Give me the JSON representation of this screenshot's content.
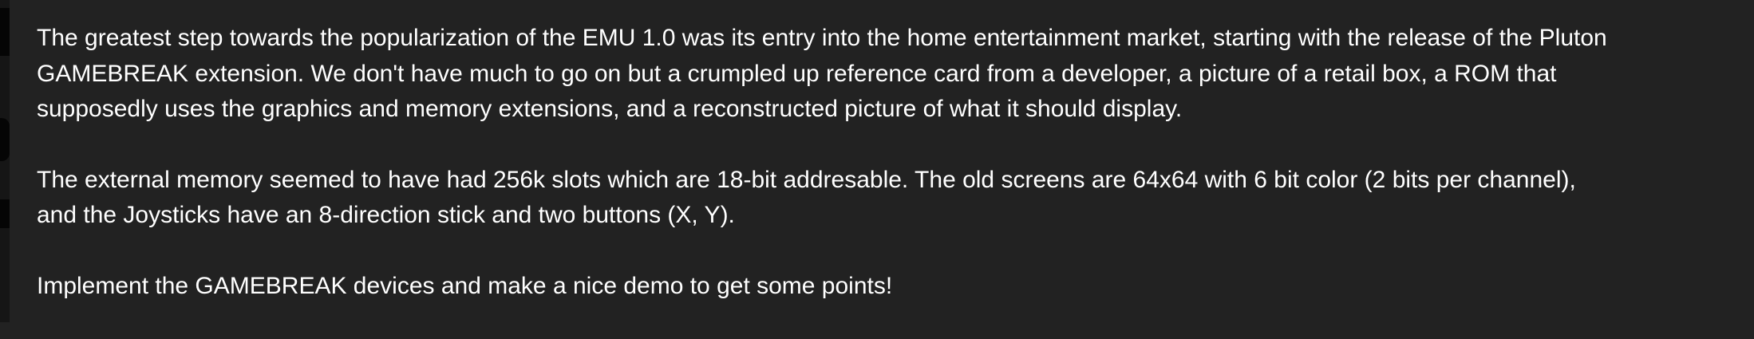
{
  "paragraphs": [
    "The greatest step towards the popularization of the EMU 1.0 was its entry into the home entertainment market, starting with the release of the Pluton\nGAMEBREAK extension. We don't have much to go on but a crumpled up reference card from a developer, a picture of a retail box, a ROM that\nsupposedly uses the graphics and memory extensions, and a reconstructed picture of what it should display.",
    "The external memory seemed to have had 256k slots which are 18-bit addresable. The old screens are 64x64 with 6 bit color (2 bits per channel),\nand the Joysticks have an 8-direction stick and two buttons (X, Y).",
    "Implement the GAMEBREAK devices and make a nice demo to get some points!"
  ]
}
